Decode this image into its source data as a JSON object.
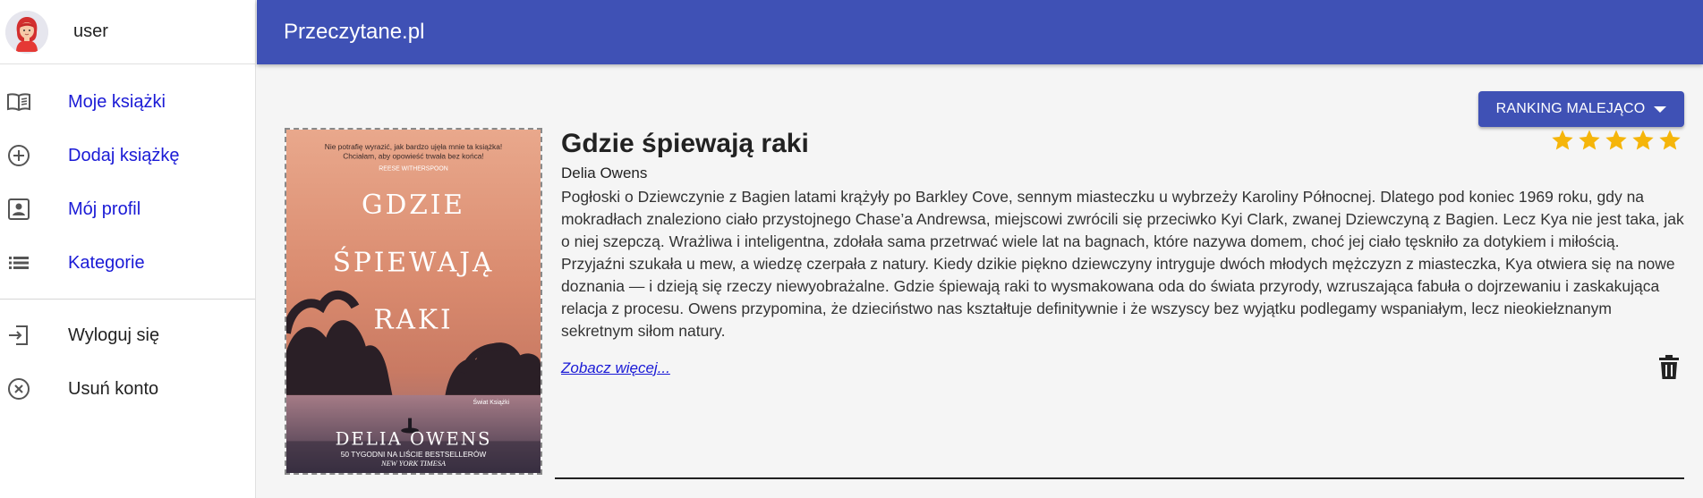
{
  "user": {
    "name": "user"
  },
  "nav": {
    "items": [
      {
        "label": "Moje książki",
        "icon": "book-open-icon"
      },
      {
        "label": "Dodaj książkę",
        "icon": "plus-circle-icon"
      },
      {
        "label": "Mój profil",
        "icon": "profile-card-icon"
      },
      {
        "label": "Kategorie",
        "icon": "list-icon"
      }
    ],
    "secondary": [
      {
        "label": "Wyloguj się",
        "icon": "logout-icon"
      },
      {
        "label": "Usuń konto",
        "icon": "close-circle-icon"
      }
    ]
  },
  "header": {
    "title": "Przeczytane.pl"
  },
  "sort": {
    "label": "RANKING MALEJĄCO"
  },
  "book": {
    "title": "Gdzie śpiewają raki",
    "author": "Delia Owens",
    "description": "Pogłoski o Dziewczynie z Bagien latami krążyły po Barkley Cove, sennym miasteczku u wybrzeży Karoliny Północnej. Dlatego pod koniec 1969 roku, gdy na mokradłach znaleziono ciało przystojnego Chase’a Andrewsa, miejscowi zwrócili się przeciwko Kyi Clark, zwanej Dziewczyną z Bagien. Lecz Kya nie jest taka, jak o niej szepczą. Wrażliwa i inteligentna, zdołała sama przetrwać wiele lat na bagnach, które nazywa domem, choć jej ciało tęskniło za dotykiem i miłością. Przyjaźni szukała u mew, a wiedzę czerpała z natury. Kiedy dzikie piękno dziewczyny intryguje dwóch młodych mężczyzn z miasteczka, Kya otwiera się na nowe doznania — i dzieją się rzeczy niewyobrażalne. Gdzie śpiewają raki to wysmakowana oda do świata przyrody, wzruszająca fabuła o dojrzewaniu i zaskakująca relacja z procesu. Owens przypomina, że dzieciństwo nas kształtuje definitywnie i że wszyscy bez wyjątku podlegamy wspaniałym, lecz nieokiełznanym sekretnym siłom natury.",
    "see_more": "Zobacz więcej...",
    "rating": 5,
    "rating_max": 5,
    "star_color": "#f5b50a",
    "cover": {
      "quote_line1": "Nie potrafię wyrazić, jak bardzo ujęła mnie ta książka!",
      "quote_line2": "Chciałam, aby opowieść trwała bez końca!",
      "quote_author": "REESE WITHERSPOON",
      "title_line1": "GDZIE",
      "title_line2": "ŚPIEWAJĄ",
      "title_line3": "RAKI",
      "publisher": "Świat Książki",
      "author": "DELIA OWENS",
      "tagline1": "50 TYGODNI NA LIŚCIE BESTSELLERÓW",
      "tagline2": "NEW YORK TIMESA"
    }
  },
  "colors": {
    "primary": "#3f51b5",
    "link": "#1a1ad6"
  }
}
